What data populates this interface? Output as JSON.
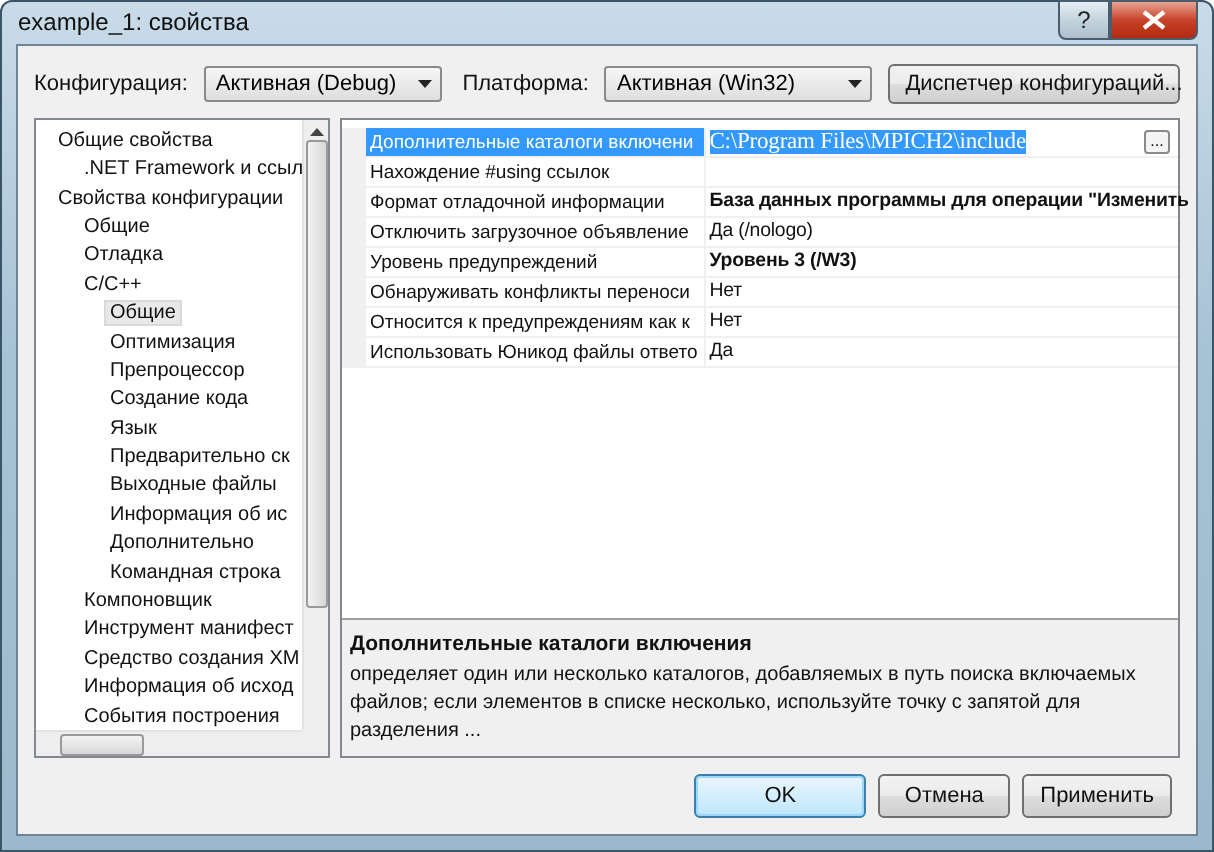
{
  "window": {
    "title": "example_1: свойства",
    "help_button": "?"
  },
  "toolbar": {
    "configuration_label": "Конфигурация:",
    "configuration_value": "Активная (Debug)",
    "platform_label": "Платформа:",
    "platform_value": "Активная (Win32)",
    "manager_button": "Диспетчер конфигураций..."
  },
  "tree": {
    "items": [
      {
        "label": "Общие свойства",
        "selected": false,
        "children": [
          {
            "label": ".NET Framework и ссыл",
            "selected": false
          }
        ]
      },
      {
        "label": "Свойства конфигурации",
        "selected": false,
        "children": [
          {
            "label": "Общие",
            "selected": false
          },
          {
            "label": "Отладка",
            "selected": false
          },
          {
            "label": "C/C++",
            "selected": false,
            "children": [
              {
                "label": "Общие",
                "selected": true
              },
              {
                "label": "Оптимизация",
                "selected": false
              },
              {
                "label": "Препроцессор",
                "selected": false
              },
              {
                "label": "Создание кода",
                "selected": false
              },
              {
                "label": "Язык",
                "selected": false
              },
              {
                "label": "Предварительно ск",
                "selected": false
              },
              {
                "label": "Выходные файлы",
                "selected": false
              },
              {
                "label": "Информация об ис",
                "selected": false
              },
              {
                "label": "Дополнительно",
                "selected": false
              },
              {
                "label": "Командная строка",
                "selected": false
              }
            ]
          },
          {
            "label": "Компоновщик",
            "selected": false
          },
          {
            "label": "Инструмент манифест",
            "selected": false
          },
          {
            "label": "Средство создания ХМ",
            "selected": false
          },
          {
            "label": "Информация об исход",
            "selected": false
          },
          {
            "label": "События построения",
            "selected": false
          }
        ]
      }
    ]
  },
  "properties": [
    {
      "name": "Дополнительные каталоги включени",
      "value": "C:\\Program Files\\MPICH2\\include",
      "bold": false,
      "selected": true
    },
    {
      "name": "Нахождение #using ссылок",
      "selected": false
    },
    {
      "name": "Формат отладочной информации",
      "value": "База данных программы для операции \"Изменить",
      "bold": true,
      "selected": false
    },
    {
      "name": "Отключить загрузочное объявление",
      "value": "Да (/nologo)",
      "bold": false,
      "selected": false
    },
    {
      "name": "Уровень предупреждений",
      "value": "Уровень 3 (/W3)",
      "bold": true,
      "selected": false
    },
    {
      "name": "Обнаруживать конфликты переноси",
      "value": "Нет",
      "bold": false,
      "selected": false
    },
    {
      "name": "Относится к предупреждениям как к",
      "value": "Нет",
      "bold": false,
      "selected": false
    },
    {
      "name": "Использовать Юникод файлы ответо",
      "value": "Да",
      "bold": false,
      "selected": false
    }
  ],
  "browse_button": "...",
  "description": {
    "title": "Дополнительные каталоги включения",
    "text": "определяет один или несколько каталогов, добавляемых в путь поиска включаемых файлов; если элементов в списке несколько, используйте точку с запятой для разделения ..."
  },
  "buttons": [
    {
      "label": "OK",
      "default": true
    },
    {
      "label": "Отмена",
      "default": false
    },
    {
      "label": "Применить",
      "default": false
    }
  ]
}
